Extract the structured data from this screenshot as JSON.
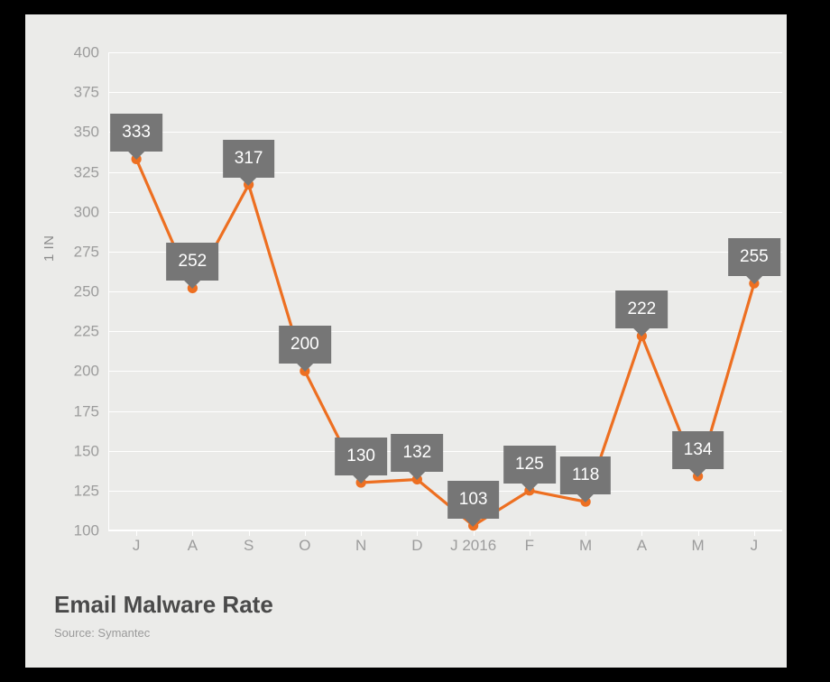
{
  "chart_data": {
    "type": "line",
    "title": "Email Malware Rate",
    "subtitle": "Source: Symantec",
    "xlabel": "",
    "ylabel": "1 IN",
    "categories": [
      "J",
      "A",
      "S",
      "O",
      "N",
      "D",
      "J 2016",
      "F",
      "M",
      "A",
      "M",
      "J"
    ],
    "values": [
      333,
      252,
      317,
      200,
      130,
      132,
      103,
      125,
      118,
      222,
      134,
      255
    ],
    "data_labels": [
      "333",
      "252",
      "317",
      "200",
      "130",
      "132",
      "103",
      "125",
      "118",
      "222",
      "134",
      "255"
    ],
    "ylim": [
      100,
      400
    ],
    "ytick_step": 25,
    "ytick_labels": [
      "400",
      "375",
      "350",
      "325",
      "300",
      "275",
      "250",
      "225",
      "200",
      "175",
      "150",
      "125",
      "100"
    ],
    "ytick_values": [
      400,
      375,
      350,
      325,
      300,
      275,
      250,
      225,
      200,
      175,
      150,
      125,
      100
    ],
    "grid": true,
    "legend": false,
    "series": [
      {
        "name": "Email Malware Rate",
        "values": [
          333,
          252,
          317,
          200,
          130,
          132,
          103,
          125,
          118,
          222,
          134,
          255
        ]
      }
    ],
    "colors": {
      "line": "#ed6f21",
      "marker": "#ed6f21",
      "label_box": "#767676",
      "label_text": "#ffffff",
      "plot_background": "#ebebe9",
      "gridline": "#ffffff",
      "tick_text": "#9c9c9c",
      "title_text": "#4a4a4a",
      "source_text": "#9a9a9a",
      "frame": "#000000"
    }
  }
}
